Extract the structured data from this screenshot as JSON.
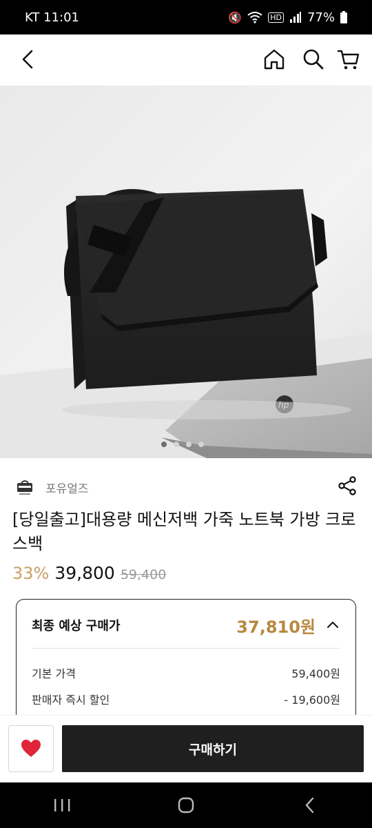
{
  "status": {
    "carrier_time": "KT 11:01",
    "battery": "77%",
    "hd": "HD"
  },
  "product": {
    "seller_name": "포유얼즈",
    "title": "[당일출고]대용량 메신저백 가죽 노트북 가방 크로스백",
    "discount": "33%",
    "price": "39,800",
    "original_price": "59,400",
    "image_page": {
      "current": 1,
      "total": 4
    }
  },
  "summary": {
    "label": "최종 예상 구매가",
    "total": "37,810원",
    "lines": [
      {
        "label": "기본 가격",
        "value": "59,400원"
      },
      {
        "label": "판매자 즉시 할인",
        "value": "- 19,600원"
      }
    ]
  },
  "actions": {
    "buy_label": "구매하기"
  },
  "colors": {
    "accent": "#c8a064",
    "total": "#b7893f",
    "button": "#1f1f1f",
    "heart": "#e0243a"
  }
}
